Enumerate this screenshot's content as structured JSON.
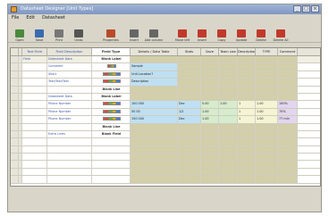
{
  "window": {
    "title": "Datasheet Designer [Unit Types]"
  },
  "menu": [
    "File",
    "Edit",
    "Datasheet"
  ],
  "toolbar": {
    "items": [
      {
        "label": "Open",
        "icon": "open-folder-icon",
        "color": "#4a8a3a"
      },
      {
        "label": "Save",
        "icon": "save-icon",
        "color": "#3a6ab0"
      },
      {
        "label": "Print",
        "icon": "print-icon",
        "color": "#777777"
      },
      {
        "label": "Undo",
        "icon": "undo-icon",
        "color": "#555555"
      },
      {
        "label": "Properties",
        "icon": "properties-icon",
        "color": "#b84a2a"
      },
      {
        "label": "Insert",
        "icon": "insert-row-icon",
        "color": "#666666"
      },
      {
        "label": "Add column",
        "icon": "add-column-icon",
        "color": "#666666"
      },
      {
        "label": "Move left",
        "icon": "move-left-icon",
        "color": "#c0392b"
      },
      {
        "label": "Insert",
        "icon": "insert-icon",
        "color": "#c0392b"
      },
      {
        "label": "Copy",
        "icon": "copy-icon",
        "color": "#c0392b"
      },
      {
        "label": "Update",
        "icon": "update-icon",
        "color": "#c0392b"
      },
      {
        "label": "Delete",
        "icon": "delete-icon",
        "color": "#c0392b"
      },
      {
        "label": "Delete All",
        "icon": "delete-all-icon",
        "color": "#c0392b"
      }
    ]
  },
  "grid": {
    "headers": [
      "",
      "",
      "Text Field",
      "Field Description",
      "Field Type",
      "Details / Data Table",
      "Stats",
      "Save",
      "Team size",
      "Description",
      "TYPE",
      "Comment"
    ],
    "rows": [
      {
        "field": "Field",
        "desc": "Datasheet Data",
        "type": "Blank Label",
        "kind": "label",
        "bg": "olive"
      },
      {
        "field": "",
        "desc": "Comment",
        "type": "",
        "kind": "tag",
        "bg": "blue"
      },
      {
        "field": "",
        "desc": "Short",
        "type": "Freedom",
        "kind": "bar",
        "bg": "blue"
      },
      {
        "field": "",
        "desc": "Text/Text/Text",
        "type": "Freedom",
        "kind": "bar",
        "bg": "blue"
      },
      {
        "field": "",
        "desc": "",
        "type": "Blank Line",
        "kind": "label",
        "bg": "olive"
      },
      {
        "field": "",
        "desc": "Datasheet Data",
        "type": "Blank Label",
        "kind": "label",
        "bg": "olive"
      },
      {
        "field": "",
        "desc": "Phone Number",
        "type": "Freedom",
        "kind": "bar",
        "bg": "data"
      },
      {
        "field": "",
        "desc": "Phone Number",
        "type": "Freedom",
        "kind": "bar",
        "bg": "data"
      },
      {
        "field": "",
        "desc": "Phone Number",
        "type": "Freedom",
        "kind": "bar",
        "bg": "data"
      },
      {
        "field": "",
        "desc": "",
        "type": "Blank Line",
        "kind": "label",
        "bg": "olive"
      },
      {
        "field": "",
        "desc": "Extra Lines",
        "type": "Blank Field",
        "kind": "label",
        "bg": "olive"
      }
    ],
    "details": {
      "block1": [
        "Sample",
        "Phone & Email",
        "Unit Location?"
      ],
      "block2": [
        "Description",
        "Additional comments"
      ],
      "data": [
        [
          "100 000",
          "Dec",
          "5.00",
          "1.00",
          "1",
          "1.00",
          "100%"
        ],
        [
          "50 00",
          "1/2",
          "1.00",
          "",
          "1",
          "1.00",
          "70%"
        ],
        [
          "150 000",
          "Dec",
          "1.00",
          "",
          "1",
          "1.00",
          "77 min"
        ]
      ]
    }
  }
}
